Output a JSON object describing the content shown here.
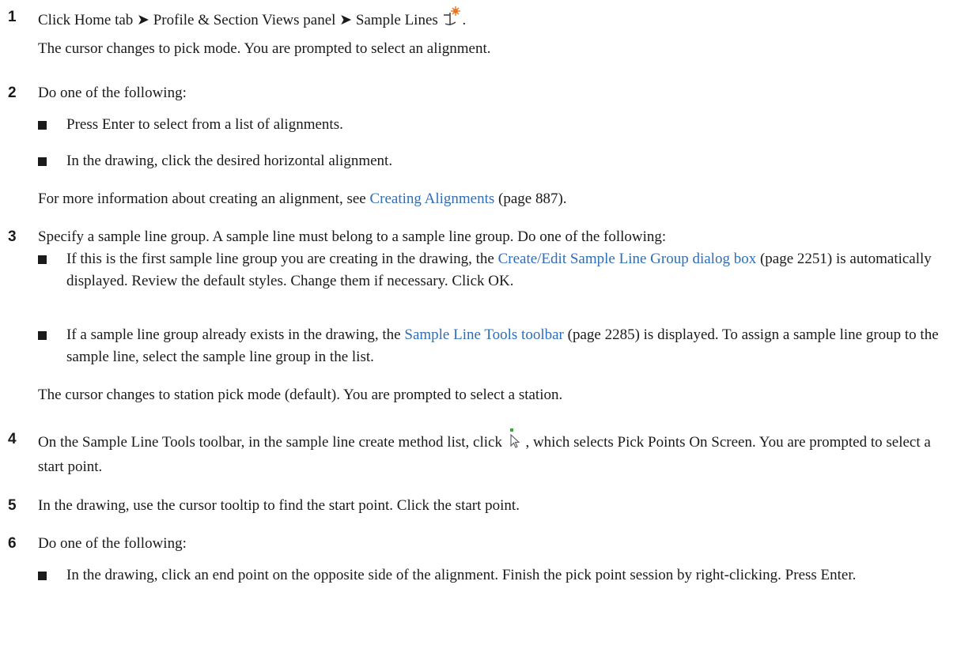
{
  "steps": [
    {
      "num": "1",
      "text_before_icon": "Click Home tab ➤ Profile & Section Views panel ➤ Sample Lines",
      "icon": "sample-lines-icon",
      "text_after_icon": ".",
      "result": "The cursor changes to pick mode. You are prompted to select an alignment."
    },
    {
      "num": "2",
      "text": "Do one of the following:",
      "bullets": [
        "Press Enter to select from a list of alignments.",
        "In the drawing, click the desired horizontal alignment."
      ],
      "note_pre": "For more information about creating an alignment, see ",
      "note_link": "Creating Alignments",
      "note_post": " (page 887)."
    },
    {
      "num": "3",
      "text": "Specify a sample line group. A sample line must belong to a sample line group. Do one of the following:",
      "bullets": [
        {
          "pre": "If this is the first sample line group you are creating in the drawing, the ",
          "link": "Create/Edit Sample Line Group dialog box",
          "post": " (page 2251) is automatically displayed. Review the default styles. Change them if necessary. Click OK."
        },
        {
          "pre": "If a sample line group already exists in the drawing, the ",
          "link": "Sample Line Tools toolbar",
          "post": " (page 2285) is displayed. To assign a sample line group to the sample line, select the sample line group in the list."
        }
      ],
      "result": "The cursor changes to station pick mode (default). You are prompted to select a station."
    },
    {
      "num": "4",
      "text_before_icon": "On the Sample Line Tools toolbar, in the sample line create method list, click",
      "icon": "pick-points-cursor-icon",
      "text_after_icon": ", which selects Pick Points On Screen. You are prompted to select a start point."
    },
    {
      "num": "5",
      "text": "In the drawing, use the cursor tooltip to find the start point. Click the start point."
    },
    {
      "num": "6",
      "text": "Do one of the following:",
      "bullets": [
        "In the drawing, click an end point on the opposite side of the alignment. Finish the pick point session by right-clicking. Press Enter."
      ]
    }
  ]
}
